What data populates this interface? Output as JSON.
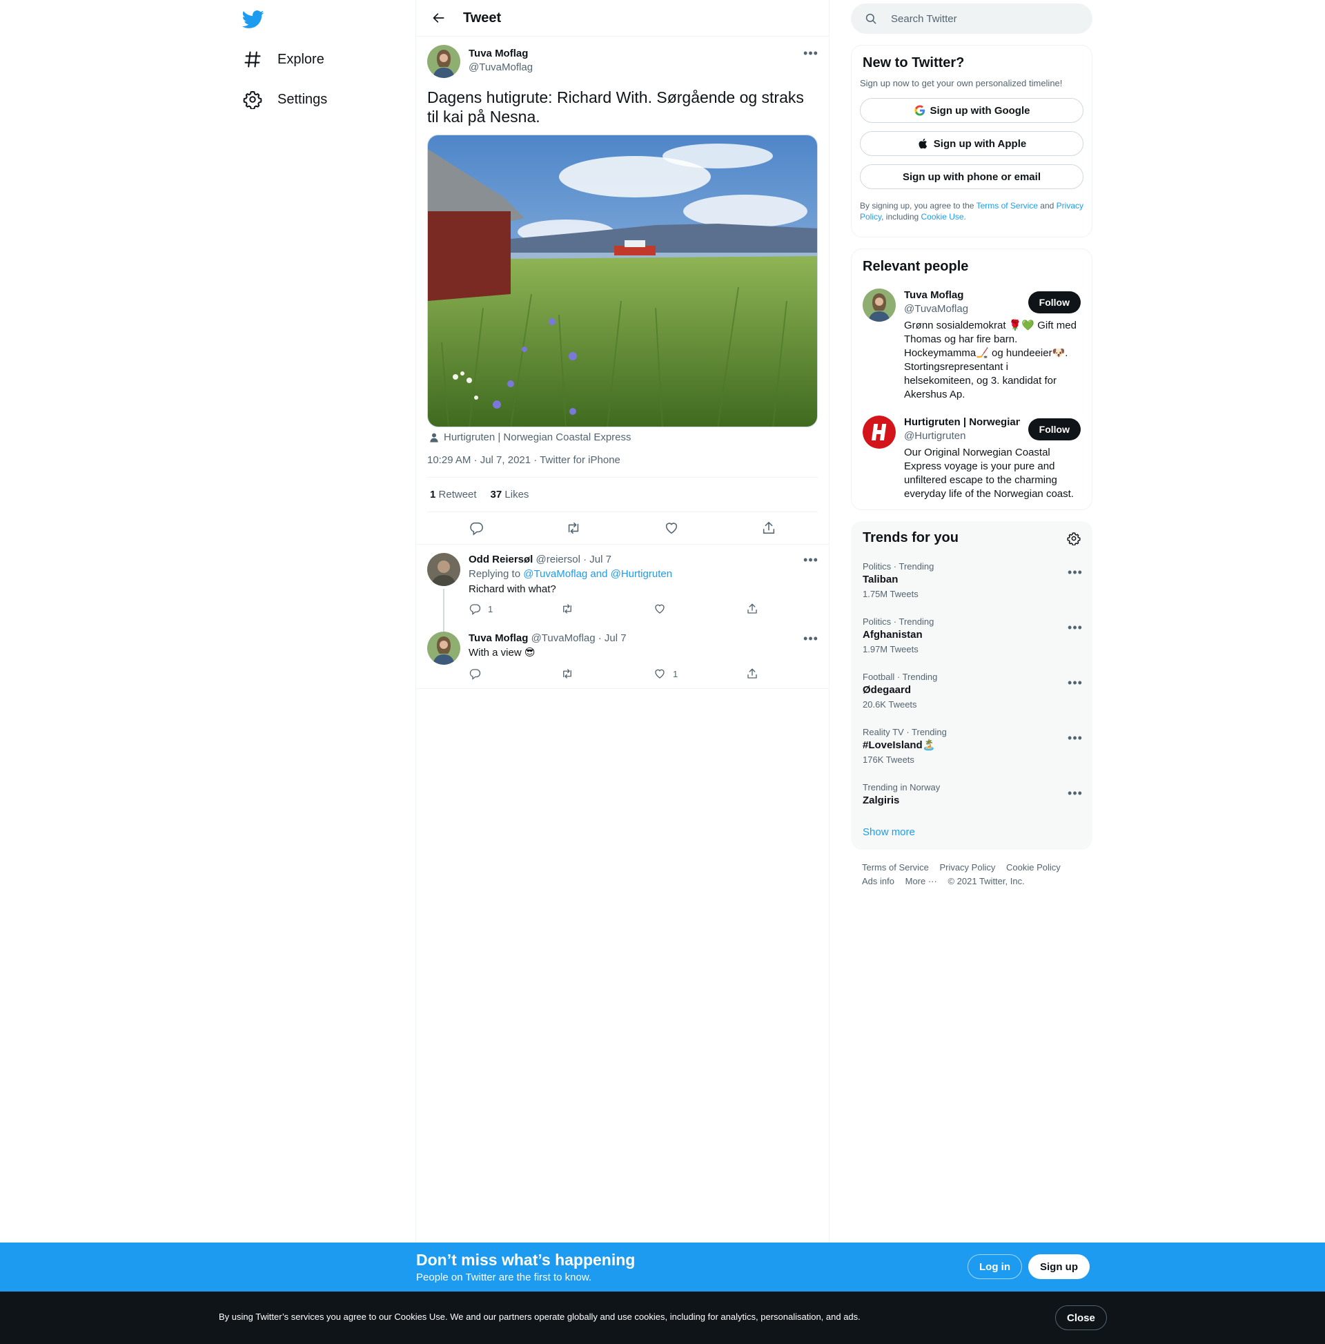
{
  "nav": {
    "logo": "twitter-bird",
    "items": [
      {
        "label": "Explore",
        "icon": "hashtag-icon"
      },
      {
        "label": "Settings",
        "icon": "gear-icon"
      }
    ]
  },
  "header": {
    "title": "Tweet"
  },
  "tweet": {
    "author_name": "Tuva Moflag",
    "author_handle": "@TuvaMoflag",
    "text": "Dagens hutigrute: Richard With. Sørgående og straks til kai på Nesna.",
    "tagged": "Hurtigruten | Norwegian Coastal Express",
    "meta": "10:29 AM · Jul 7, 2021 · Twitter for iPhone",
    "retweet_count": "1",
    "retweet_label": "Retweet",
    "like_count": "37",
    "like_label": "Likes"
  },
  "replies": [
    {
      "name": "Odd Reiersøl",
      "handle_date": "@reiersol · Jul 7",
      "replying_prefix": "Replying to",
      "replying_to": "@TuvaMoflag and @Hurtigruten",
      "text": "Richard with what?",
      "reply_count": "1",
      "retweet_count": "",
      "like_count": ""
    },
    {
      "name": "Tuva Moflag",
      "handle_date": "@TuvaMoflag · Jul 7",
      "text": "With a view 😎",
      "reply_count": "",
      "retweet_count": "",
      "like_count": "1"
    }
  ],
  "search": {
    "placeholder": "Search Twitter"
  },
  "new_to_twitter": {
    "title": "New to Twitter?",
    "subtitle": "Sign up now to get your own personalized timeline!",
    "google": "Sign up with Google",
    "apple": "Sign up with Apple",
    "phone": "Sign up with phone or email",
    "terms_1": "By signing up, you agree to the",
    "terms_link1": "Terms of Service",
    "terms_2": "and",
    "terms_link2": "Privacy Policy",
    "terms_3": ", including",
    "terms_link3": "Cookie Use."
  },
  "relevant": {
    "title": "Relevant people",
    "people": [
      {
        "name": "Tuva Moflag",
        "handle": "@TuvaMoflag",
        "bio": "Grønn sosialdemokrat 🌹💚 Gift med Thomas og har fire barn. Hockeymamma🏒 og hundeeier🐶. Stortingsrepresentant i helsekomiteen, og 3. kandidat for Akershus Ap.",
        "follow": "Follow"
      },
      {
        "name": "Hurtigruten | Norwegian",
        "handle": "@Hurtigruten",
        "bio": "Our Original Norwegian Coastal Express voyage is your pure and unfiltered escape to the charming everyday life of the Norwegian coast.",
        "follow": "Follow"
      }
    ]
  },
  "trends": {
    "title": "Trends for you",
    "items": [
      {
        "category": "Politics · Trending",
        "name": "Taliban",
        "count": "1.75M Tweets"
      },
      {
        "category": "Politics · Trending",
        "name": "Afghanistan",
        "count": "1.97M Tweets"
      },
      {
        "category": "Football · Trending",
        "name": "Ødegaard",
        "count": "20.6K Tweets"
      },
      {
        "category": "Reality TV · Trending",
        "name": "#LoveIsland🏝️",
        "count": "176K Tweets"
      },
      {
        "category": "Trending in Norway",
        "name": "Zalgiris",
        "count": ""
      }
    ],
    "show_more": "Show more"
  },
  "footer": {
    "links": [
      "Terms of Service",
      "Privacy Policy",
      "Cookie Policy",
      "Ads info",
      "More ···",
      "© 2021 Twitter, Inc."
    ]
  },
  "banner": {
    "title": "Don’t miss what’s happening",
    "subtitle": "People on Twitter are the first to know.",
    "login": "Log in",
    "signup": "Sign up"
  },
  "cookie": {
    "text": "By using Twitter’s services you agree to our Cookies Use. We and our partners operate globally and use cookies, including for analytics, personalisation, and ads.",
    "close": "Close"
  },
  "colors": {
    "accent": "#1d9bf0",
    "text": "#0f1419",
    "muted": "#536471",
    "dark": "#0f1419"
  }
}
